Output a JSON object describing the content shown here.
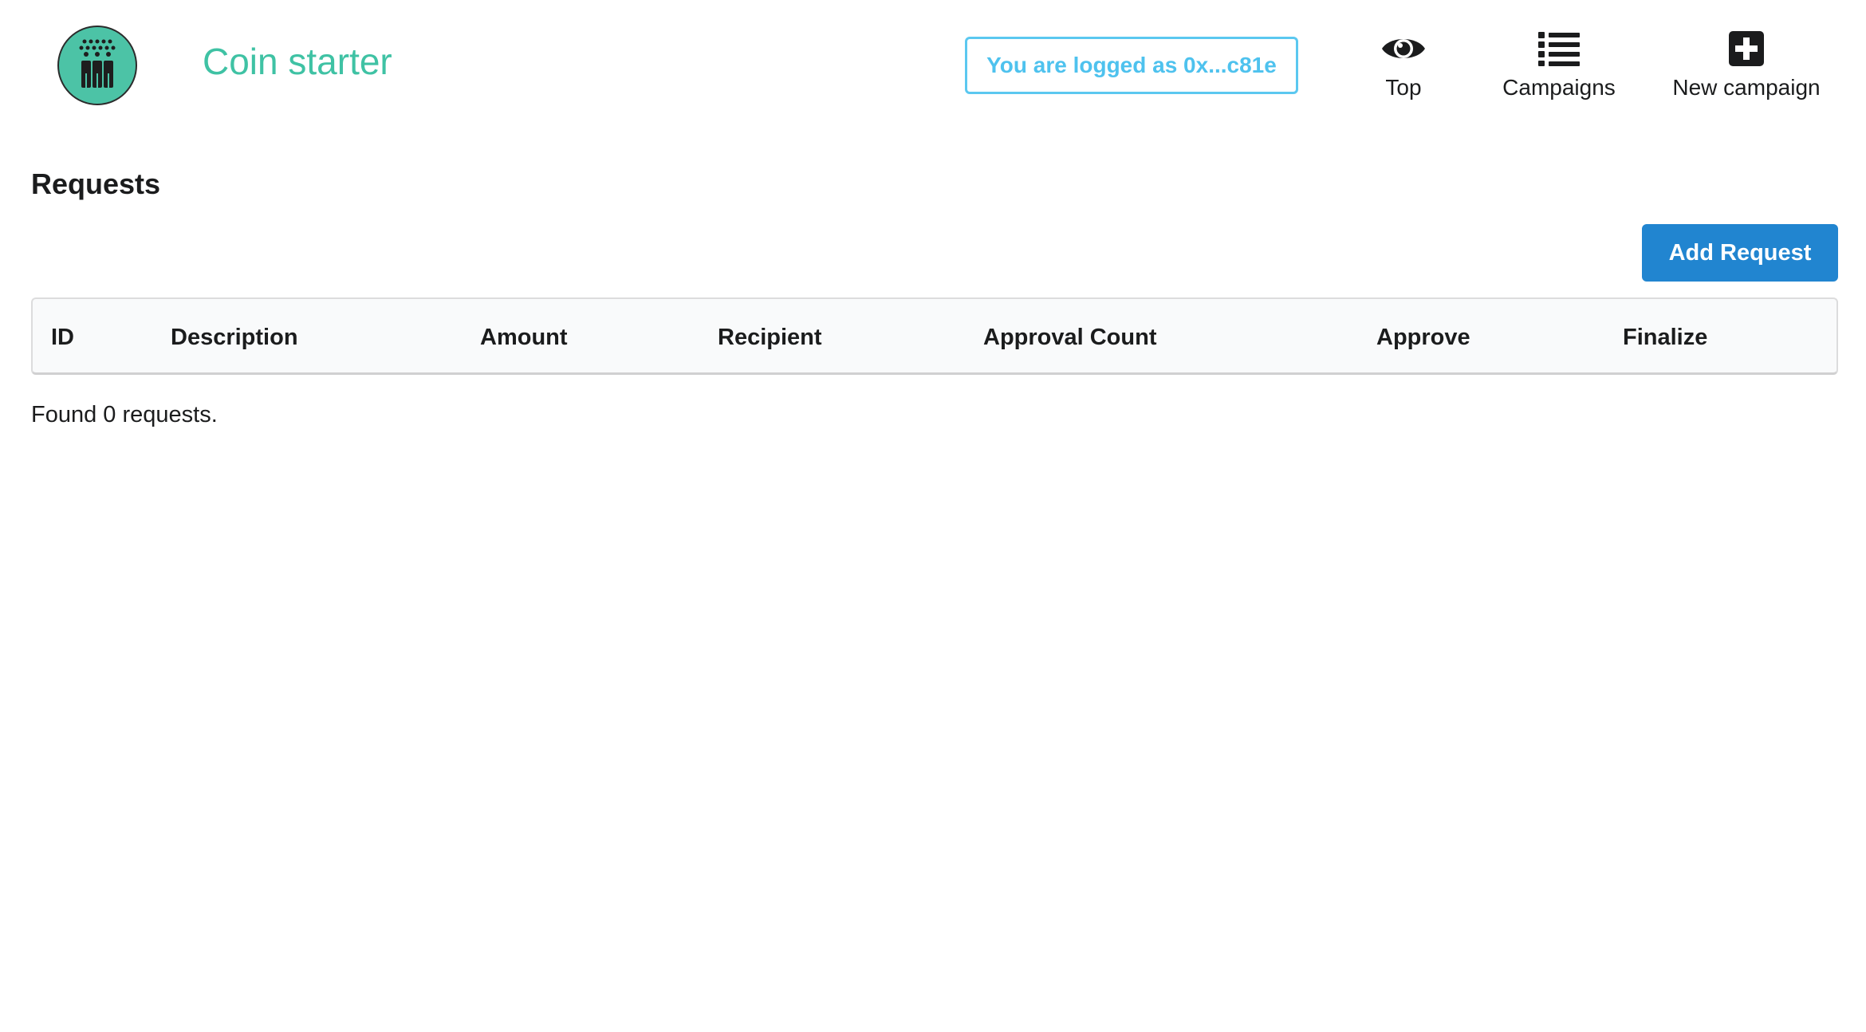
{
  "header": {
    "brand": "Coin starter",
    "login_status": "You are logged as 0x...c81e",
    "nav": [
      {
        "label": "Top",
        "icon": "eye-icon"
      },
      {
        "label": "Campaigns",
        "icon": "list-icon"
      },
      {
        "label": "New campaign",
        "icon": "plus-square-icon"
      }
    ]
  },
  "main": {
    "title": "Requests",
    "add_button": "Add Request",
    "table": {
      "columns": [
        "ID",
        "Description",
        "Amount",
        "Recipient",
        "Approval Count",
        "Approve",
        "Finalize"
      ],
      "rows": []
    },
    "status": "Found 0 requests."
  },
  "colors": {
    "brand": "#3fc2a4",
    "logo_bg": "#4cc3a6",
    "login_border": "#5bc8f0",
    "primary_button": "#2185d0",
    "table_header_bg": "#f9fafb"
  }
}
